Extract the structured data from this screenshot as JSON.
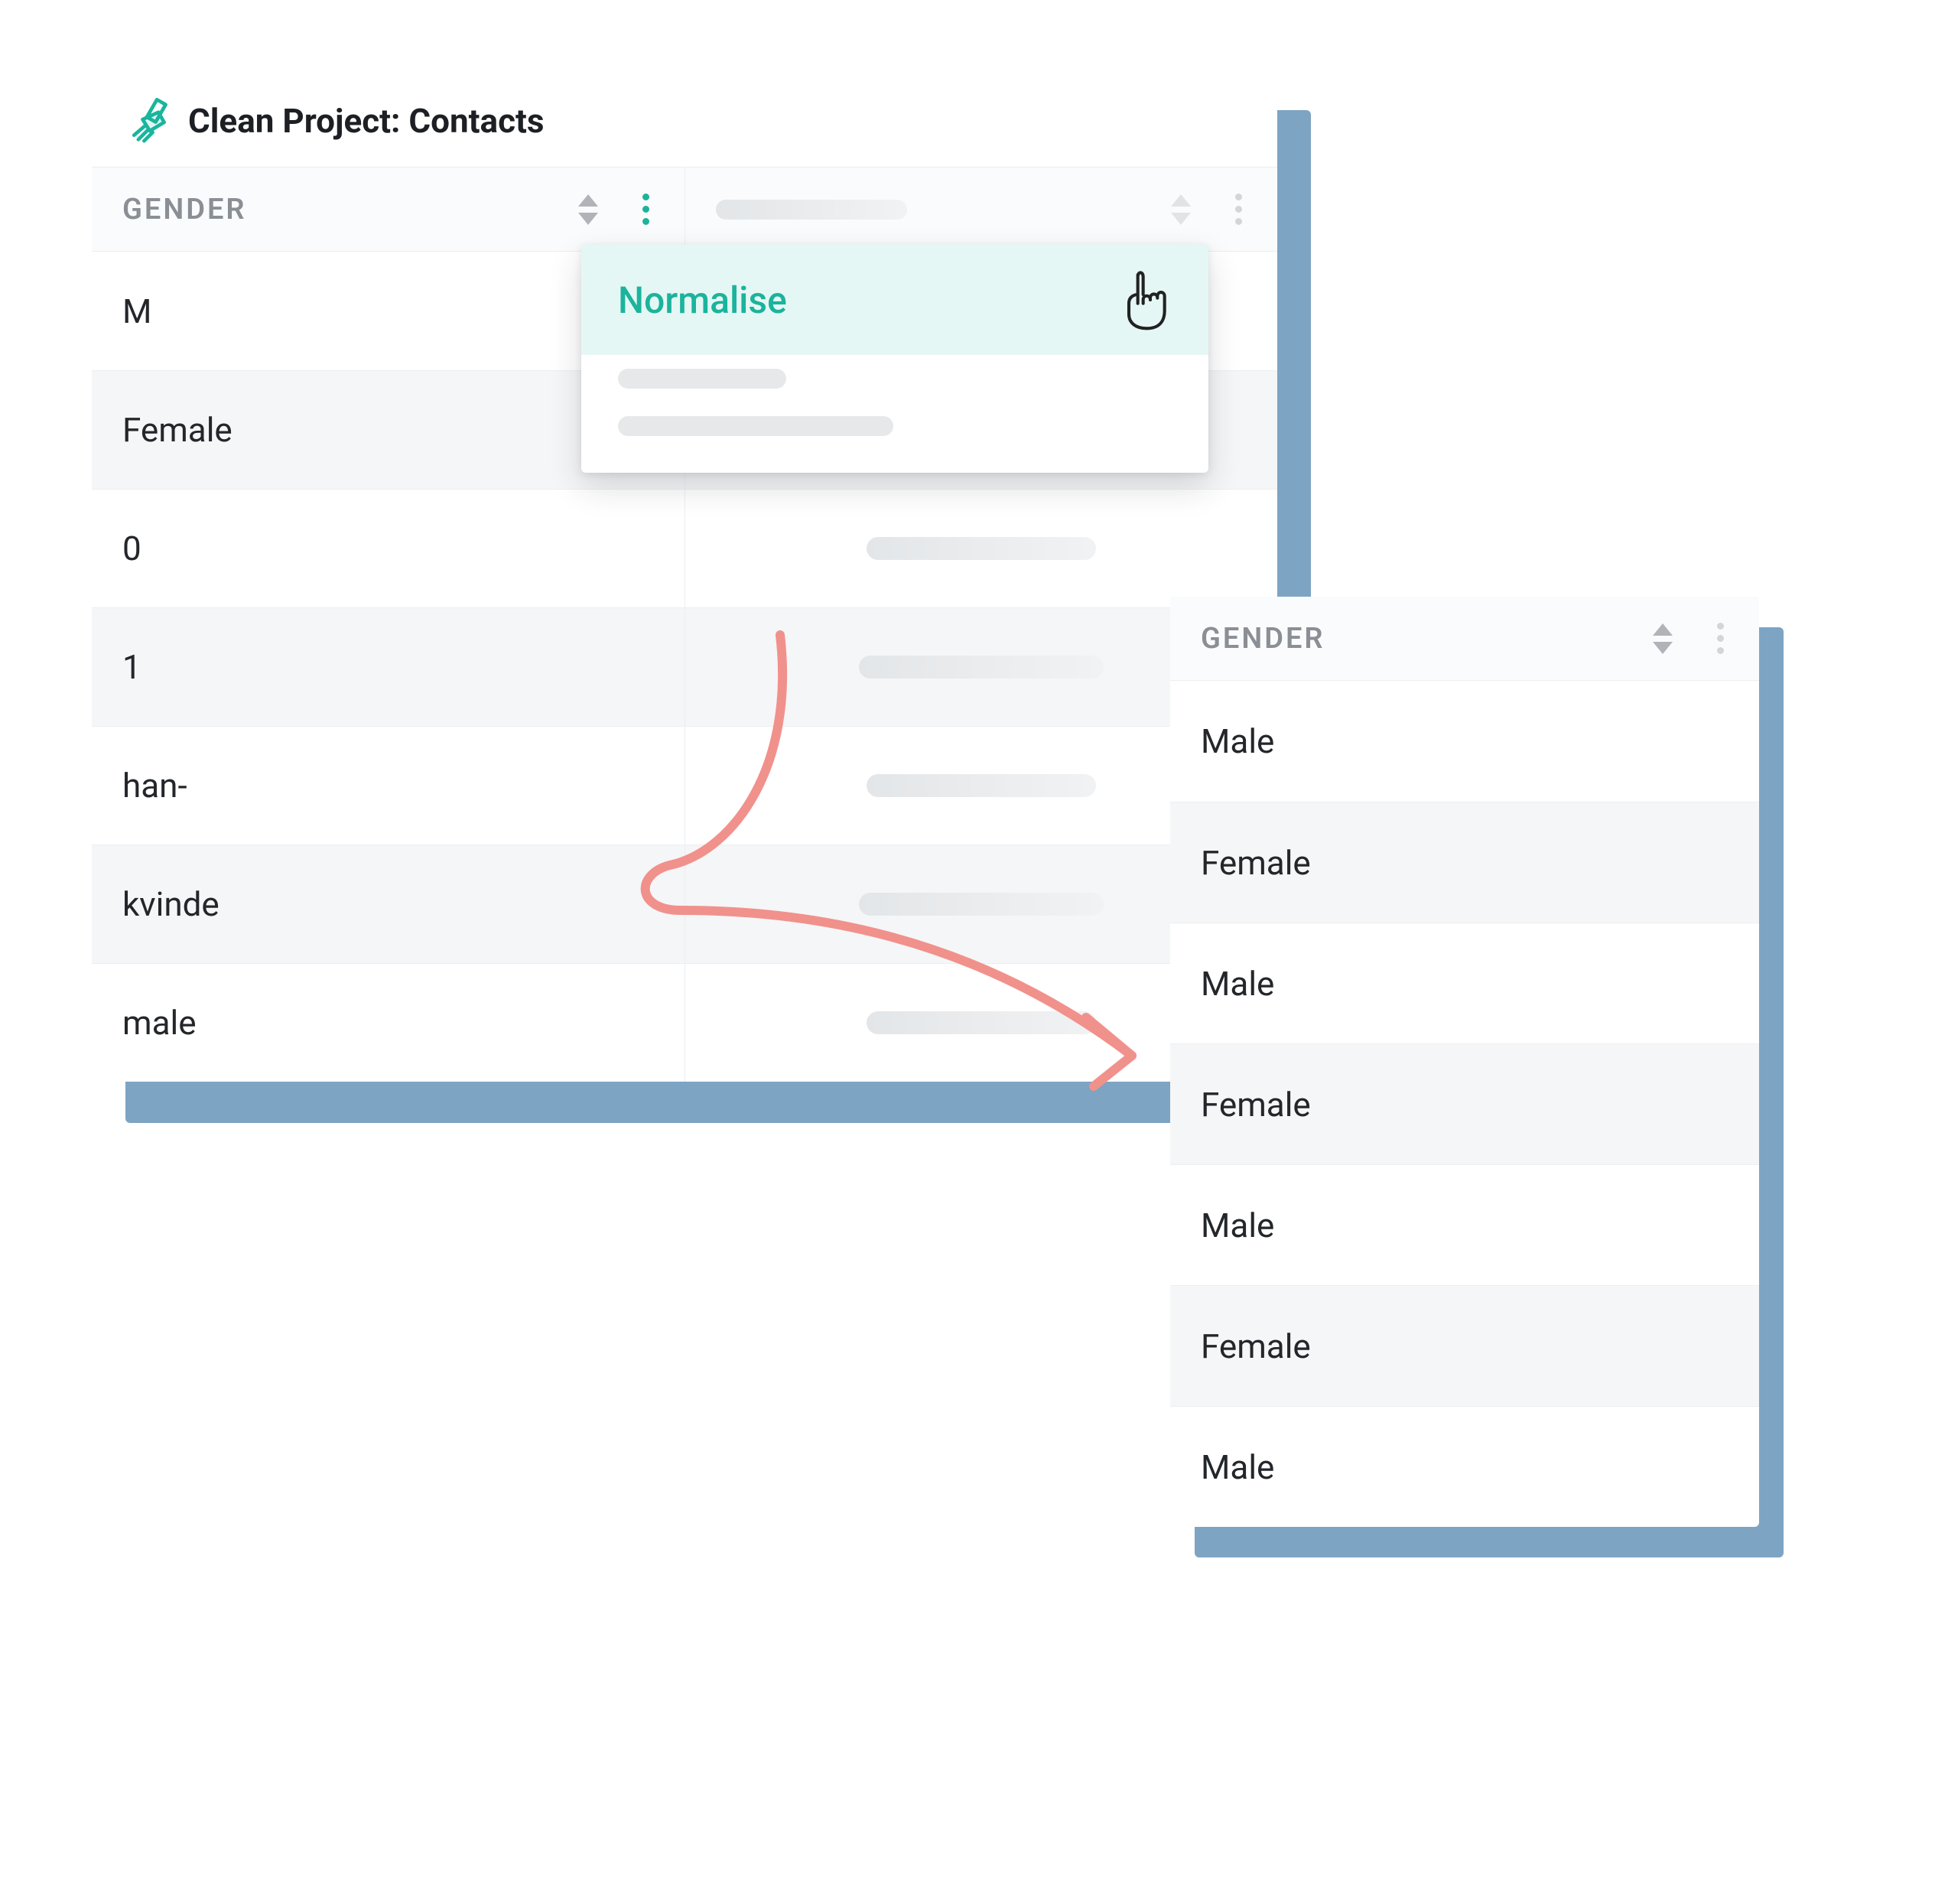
{
  "colors": {
    "accent": "#1bb39c",
    "arrow": "#f6a7a2",
    "shadow": "#7da4c3"
  },
  "title": "Clean Project: Contacts",
  "columns": {
    "gender_label": "GENDER"
  },
  "menu": {
    "normalise": "Normalise"
  },
  "source_rows": [
    "M",
    "Female",
    "0",
    "1",
    "han-",
    "kvinde",
    "male"
  ],
  "result": {
    "header": "GENDER",
    "rows": [
      "Male",
      "Female",
      "Male",
      "Female",
      "Male",
      "Female",
      "Male"
    ]
  }
}
